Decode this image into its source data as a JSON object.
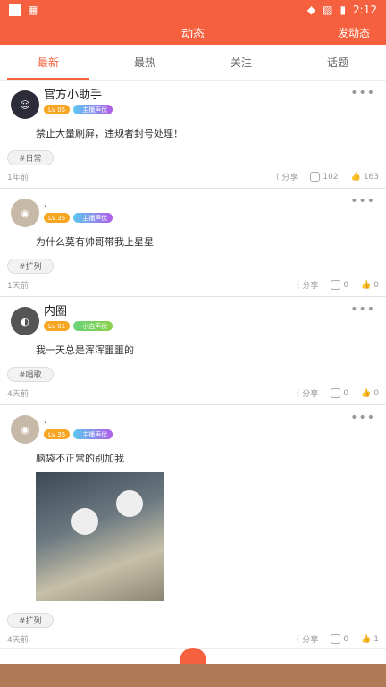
{
  "status_bar": {
    "time": "2:12"
  },
  "app_bar": {
    "title": "动态",
    "action": "发动态"
  },
  "tabs": [
    {
      "label": "最新",
      "active": true
    },
    {
      "label": "最热",
      "active": false
    },
    {
      "label": "关注",
      "active": false
    },
    {
      "label": "话题",
      "active": false
    }
  ],
  "posts": [
    {
      "username": "官方小助手",
      "level": "05",
      "role": "主播声优",
      "content": "禁止大量刷屏，违规者封号处理！",
      "tag": "#日常",
      "time": "1年前",
      "share": "分享",
      "comments": "102",
      "likes": "163"
    },
    {
      "username": ".",
      "level": "35",
      "role": "主播声优",
      "content": "为什么莫有帅哥带我上星星",
      "tag": "#扩列",
      "time": "1天前",
      "share": "分享",
      "comments": "0",
      "likes": "0"
    },
    {
      "username": "内圈",
      "level": "01",
      "role": "小白声优",
      "content": "我一天总是浑浑噩噩的",
      "tag": "#唱歌",
      "time": "4天前",
      "share": "分享",
      "comments": "0",
      "likes": "0"
    },
    {
      "username": ".",
      "level": "35",
      "role": "主播声优",
      "content": "脑袋不正常的别加我",
      "tag": "#扩列",
      "time": "4天前",
      "share": "分享",
      "comments": "0",
      "likes": "1"
    }
  ],
  "colors": {
    "brand": "#f5613f"
  }
}
